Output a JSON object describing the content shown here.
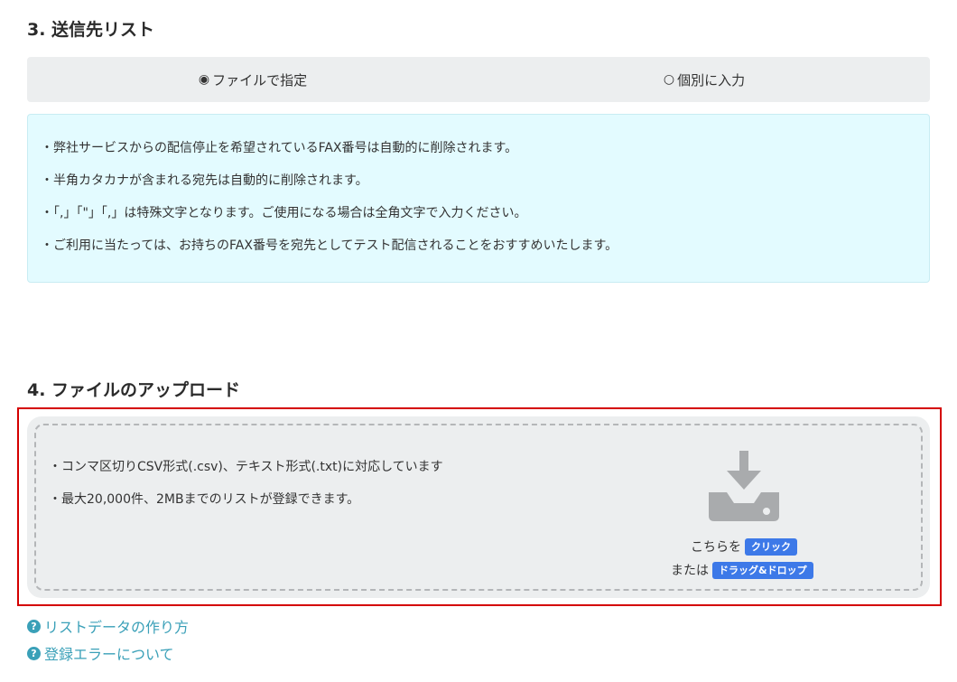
{
  "section3": {
    "heading": "3. 送信先リスト",
    "tabs": [
      {
        "radio_glyph": "◉",
        "label": "ファイルで指定",
        "selected": true
      },
      {
        "radio_glyph": "○",
        "label": "個別に入力",
        "selected": false
      }
    ],
    "notices": [
      "・弊社サービスからの配信停止を希望されているFAX番号は自動的に削除されます。",
      "・半角カタカナが含まれる宛先は自動的に削除されます。",
      "・「,」「\"」「,」は特殊文字となります。ご使用になる場合は全角文字で入力ください。",
      "・ご利用に当たっては、お持ちのFAX番号を宛先としてテスト配信されることをおすすめいたします。"
    ]
  },
  "section4": {
    "heading": "4. ファイルのアップロード",
    "dropzone": {
      "notes": [
        "・コンマ区切りCSV形式(.csv)、テキスト形式(.txt)に対応しています",
        "・最大20,000件、2MBまでのリストが登録できます。"
      ],
      "icon": "download-tray-icon",
      "line1_prefix": "こちらを",
      "click_label": "クリック",
      "line2_prefix": "または",
      "drag_label": "ドラッグ&ドロップ"
    }
  },
  "help_links": [
    {
      "icon": "question-circle-icon",
      "glyph": "?",
      "label": "リストデータの作り方"
    },
    {
      "icon": "question-circle-icon",
      "glyph": "?",
      "label": "登録エラーについて"
    }
  ],
  "colors": {
    "accent_blue": "#3d79e8",
    "link_teal": "#3aa0b8",
    "highlight_red": "#d40000",
    "notice_bg": "#e3fbff",
    "panel_gray": "#eceeef"
  }
}
